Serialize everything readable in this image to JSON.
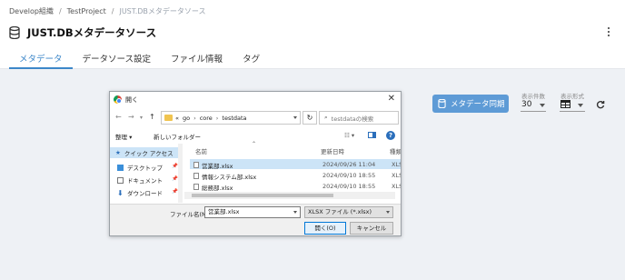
{
  "breadcrumb": {
    "org": "Develop組織",
    "project": "TestProject",
    "current": "JUST.DBメタデータソース",
    "sep": "/"
  },
  "header": {
    "title": "JUST.DBメタデータソース"
  },
  "tabs": [
    {
      "label": "メタデータ",
      "active": true
    },
    {
      "label": "データソース設定",
      "active": false
    },
    {
      "label": "ファイル情報",
      "active": false
    },
    {
      "label": "タグ",
      "active": false
    }
  ],
  "right_panel": {
    "sync_label": "メタデータ同期",
    "count_label": "表示件数",
    "count_value": "30",
    "format_label": "表示形式"
  },
  "dialog": {
    "title": "開く",
    "close": "✕",
    "address": {
      "prefix": "«",
      "parts": [
        "go",
        "core",
        "testdata"
      ],
      "chev": "›"
    },
    "search_placeholder": "testdataの検索",
    "organize": "整理 ▾",
    "new_folder": "新しいフォルダー",
    "nav": {
      "quick_access": "クイック アクセス",
      "items": [
        "デスクトップ",
        "ドキュメント",
        "ダウンロード"
      ]
    },
    "columns": {
      "name": "名前",
      "date": "更新日時",
      "type": "種類"
    },
    "files": [
      {
        "name": "営業部.xlsx",
        "date": "2024/09/26 11:04",
        "type": "XLSX",
        "selected": true
      },
      {
        "name": "情報システム部.xlsx",
        "date": "2024/09/10 18:55",
        "type": "XLSX",
        "selected": false
      },
      {
        "name": "総務部.xlsx",
        "date": "2024/09/10 18:55",
        "type": "XLSX",
        "selected": false
      }
    ],
    "filename_label": "ファイル名(N):",
    "filename_value": "営業部.xlsx",
    "filetype_value": "XLSX ファイル (*.xlsx)",
    "open_button": "開く(O)",
    "cancel_button": "キャンセル"
  },
  "colors": {
    "accent": "#3d87c9",
    "sync_button": "#5e9bd6",
    "selection": "#cce4f7"
  }
}
